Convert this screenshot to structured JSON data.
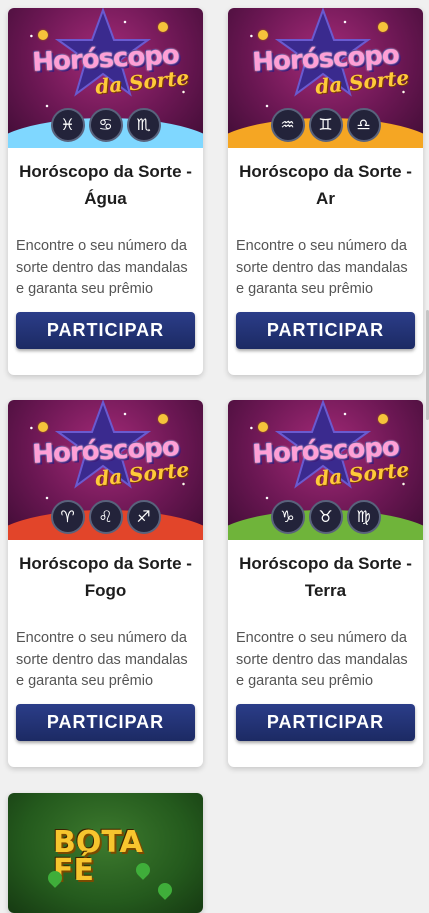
{
  "cards": [
    {
      "id": "agua",
      "title": "Horóscopo da Sorte - Água",
      "description": "Encontre o seu número da sorte dentro das mandalas e garanta seu prêmio",
      "button_label": "PARTICIPAR",
      "banner": {
        "logo_text": "Horóscopo",
        "logo_subtext": "da Sorte",
        "horizon_color": "#7fd7ff",
        "signs": [
          "♓",
          "♋",
          "♏"
        ],
        "sign_icons": [
          "pisces-icon",
          "cancer-icon",
          "scorpio-icon"
        ]
      }
    },
    {
      "id": "ar",
      "title": "Horóscopo da Sorte - Ar",
      "description": "Encontre o seu número da sorte dentro das mandalas e garanta seu prêmio",
      "button_label": "PARTICIPAR",
      "banner": {
        "logo_text": "Horóscopo",
        "logo_subtext": "da Sorte",
        "horizon_color": "#f5a623",
        "signs": [
          "♒",
          "♊",
          "♎"
        ],
        "sign_icons": [
          "aquarius-icon",
          "gemini-icon",
          "libra-icon"
        ]
      }
    },
    {
      "id": "fogo",
      "title": "Horóscopo da Sorte - Fogo",
      "description": "Encontre o seu número da sorte dentro das mandalas e garanta seu prêmio",
      "button_label": "PARTICIPAR",
      "banner": {
        "logo_text": "Horóscopo",
        "logo_subtext": "da Sorte",
        "horizon_color": "#e2452a",
        "signs": [
          "♈",
          "♌",
          "♐"
        ],
        "sign_icons": [
          "aries-icon",
          "leo-icon",
          "sagittarius-icon"
        ]
      }
    },
    {
      "id": "terra",
      "title": "Horóscopo da Sorte - Terra",
      "description": "Encontre o seu número da sorte dentro das mandalas e garanta seu prêmio",
      "button_label": "PARTICIPAR",
      "banner": {
        "logo_text": "Horóscopo",
        "logo_subtext": "da Sorte",
        "horizon_color": "#6fb43a",
        "signs": [
          "♑",
          "♉",
          "♍"
        ],
        "sign_icons": [
          "capricorn-icon",
          "taurus-icon",
          "virgo-icon"
        ]
      }
    }
  ],
  "partial_card": {
    "logo_text": "BOTA FÉ"
  },
  "colors": {
    "button_bg": "#1f2d6b",
    "page_bg": "#f0f0f0",
    "banner_bg": "#7a1a5e",
    "bota_bg": "#2a5a22"
  }
}
